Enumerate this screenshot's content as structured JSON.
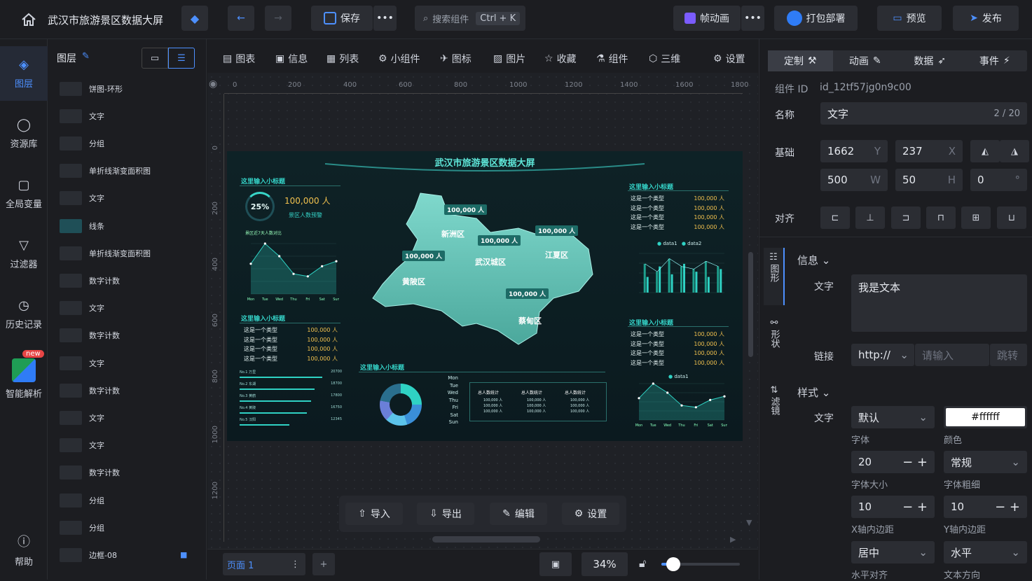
{
  "app": {
    "title": "武汉市旅游景区数据大屏"
  },
  "topbar": {
    "save_label": "保存",
    "search_label": "搜索组件",
    "search_shortcut": "Ctrl + K",
    "frame_anim_label": "帧动画",
    "package_label": "打包部署",
    "preview_label": "预览",
    "publish_label": "发布"
  },
  "leftnav": [
    {
      "label": "图层",
      "icon": "layers-icon"
    },
    {
      "label": "资源库",
      "icon": "apple-icon"
    },
    {
      "label": "全局变量",
      "icon": "variable-icon"
    },
    {
      "label": "过滤器",
      "icon": "filter-icon"
    },
    {
      "label": "历史记录",
      "icon": "clock-icon"
    },
    {
      "label": "智能解析",
      "icon": "excel-icon",
      "badge": "new"
    },
    {
      "label": "帮助",
      "icon": "help-icon"
    }
  ],
  "layers": {
    "title": "图层",
    "items": [
      {
        "label": "饼图-环形"
      },
      {
        "label": "文字"
      },
      {
        "label": "分组"
      },
      {
        "label": "单折线渐变面积图"
      },
      {
        "label": "文字"
      },
      {
        "label": "线条"
      },
      {
        "label": "单折线渐变面积图"
      },
      {
        "label": "数字计数"
      },
      {
        "label": "文字"
      },
      {
        "label": "数字计数"
      },
      {
        "label": "文字"
      },
      {
        "label": "数字计数"
      },
      {
        "label": "文字"
      },
      {
        "label": "文字"
      },
      {
        "label": "数字计数"
      },
      {
        "label": "分组"
      },
      {
        "label": "分组"
      },
      {
        "label": "边框-08"
      }
    ]
  },
  "toolbar": [
    "图表",
    "信息",
    "列表",
    "小组件",
    "图标",
    "图片",
    "收藏",
    "组件",
    "三维",
    "设置"
  ],
  "ruler": {
    "h": [
      "0",
      "200",
      "400",
      "600",
      "800",
      "1000",
      "1200",
      "1400",
      "1600",
      "1800"
    ],
    "v": [
      "0",
      "200",
      "400",
      "600",
      "800",
      "1000",
      "1200"
    ]
  },
  "screen": {
    "title": "武汉市旅游景区数据大屏",
    "subtitle": "这里输入小标题",
    "percent": "25%",
    "people": "100,000 人",
    "people_label": "景区人数预警",
    "line_caption": "景区近7天人数对比",
    "row_label": "这是一个类型",
    "row_value": "100,000 人",
    "map_labels": [
      "新洲区",
      "黄陂区",
      "武汉城区",
      "江夏区",
      "蔡甸区"
    ],
    "map_value": "100,000 人",
    "legend1": "data1",
    "legend2": "data2",
    "rank": [
      "No.1 万里",
      "No.2 东湖",
      "No.3 黄鹤",
      "No.4 黄陂",
      "No.5 汉阳"
    ],
    "rank_values": [
      "20700",
      "18700",
      "17800",
      "16750",
      "12345"
    ],
    "stats": [
      "总人数统计",
      "总人数统计",
      "总人数统计"
    ],
    "days": [
      "Mon",
      "Tue",
      "Wed",
      "Thu",
      "Fri",
      "Sat",
      "Sun"
    ]
  },
  "chart_data": [
    {
      "type": "line",
      "categories": [
        "Mon",
        "Tue",
        "Wed",
        "Thu",
        "Fri",
        "Sat",
        "Sun"
      ],
      "values": [
        120,
        200,
        150,
        80,
        70,
        110,
        130
      ],
      "ylim": [
        0,
        200
      ]
    },
    {
      "type": "bar",
      "series": [
        {
          "name": "data1",
          "values": [
            110,
            80,
            130,
            100,
            90,
            120,
            100
          ]
        },
        {
          "name": "data2",
          "values": [
            60,
            100,
            70,
            110,
            80,
            60,
            90
          ]
        }
      ],
      "ylim": [
        0,
        150
      ]
    }
  ],
  "bottom": {
    "import": "导入",
    "export": "导出",
    "edit": "编辑",
    "settings": "设置",
    "page": "页面 1",
    "zoom": "34%",
    "zoom_level": 0.34
  },
  "right": {
    "tabs": [
      "定制",
      "动画",
      "数据",
      "事件"
    ],
    "component_id_label": "组件 ID",
    "component_id": "id_12tf57jg0n9c00",
    "name_label": "名称",
    "name_value": "文字",
    "name_count": "2 / 20",
    "basic_label": "基础",
    "x": "1662",
    "x_tag": "Y",
    "y": "237",
    "y_tag": "X",
    "w": "500",
    "w_tag": "W",
    "h": "50",
    "h_tag": "H",
    "rot": "0",
    "rot_tag": "°",
    "align_label": "对齐",
    "side_tabs": [
      "图形",
      "形状",
      "滤镜"
    ],
    "info_label": "信息",
    "text_label": "文字",
    "text_value": "我是文本",
    "link_label": "链接",
    "link_proto": "http://",
    "link_placeholder": "请输入",
    "link_jump": "跳转",
    "style_label": "样式",
    "style_text_label": "文字",
    "font": "默认",
    "font_caption": "字体",
    "color": "#ffffff",
    "color_caption": "颜色",
    "font_size": "20",
    "font_size_caption": "字体大小",
    "font_weight": "常规",
    "font_weight_caption": "字体粗细",
    "pad_x": "10",
    "pad_x_caption": "X轴内边距",
    "pad_y": "10",
    "pad_y_caption": "Y轴内边距",
    "halign": "居中",
    "halign_caption": "水平对齐",
    "direction": "水平",
    "direction_caption": "文本方向"
  }
}
